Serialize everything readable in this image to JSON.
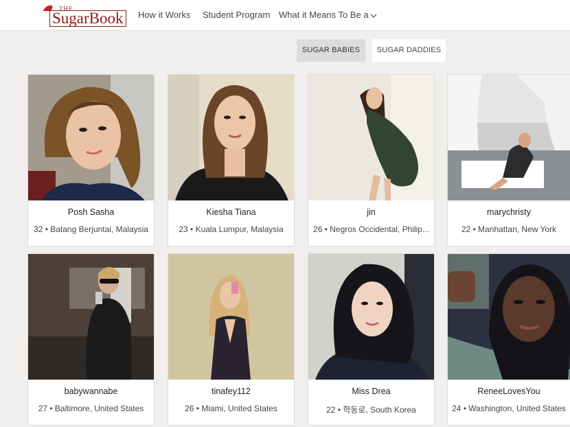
{
  "header": {
    "logo_top": "THE",
    "logo_name": "SugarBook",
    "nav": [
      "How it Works",
      "Student Program",
      "What it Means To Be a"
    ]
  },
  "tabs": {
    "active": "SUGAR BABIES",
    "inactive": "SUGAR DADDIES"
  },
  "profiles": [
    {
      "name": "Posh Sasha",
      "meta": "32 • Batang Berjuntai, Malaysia"
    },
    {
      "name": "Kiesha Tiana",
      "meta": "23 • Kuala Lumpur, Malaysia"
    },
    {
      "name": "jin",
      "meta": "26 • Negros Occidental, Philip..."
    },
    {
      "name": "marychristy",
      "meta": "22 • Manhattan, New York"
    },
    {
      "name": "babywannabe",
      "meta": "27 • Baltimore, United States"
    },
    {
      "name": "tinafey112",
      "meta": "26 • Miami, United States"
    },
    {
      "name": "Miss Drea",
      "meta": "22 • 학동로, South Korea"
    },
    {
      "name": "ReneeLovesYou",
      "meta": "24 • Washington, United States"
    }
  ],
  "colors": {
    "brand": "#8b1a1a",
    "page_bg": "#f0efed",
    "active_tab": "#dcdcdc"
  }
}
